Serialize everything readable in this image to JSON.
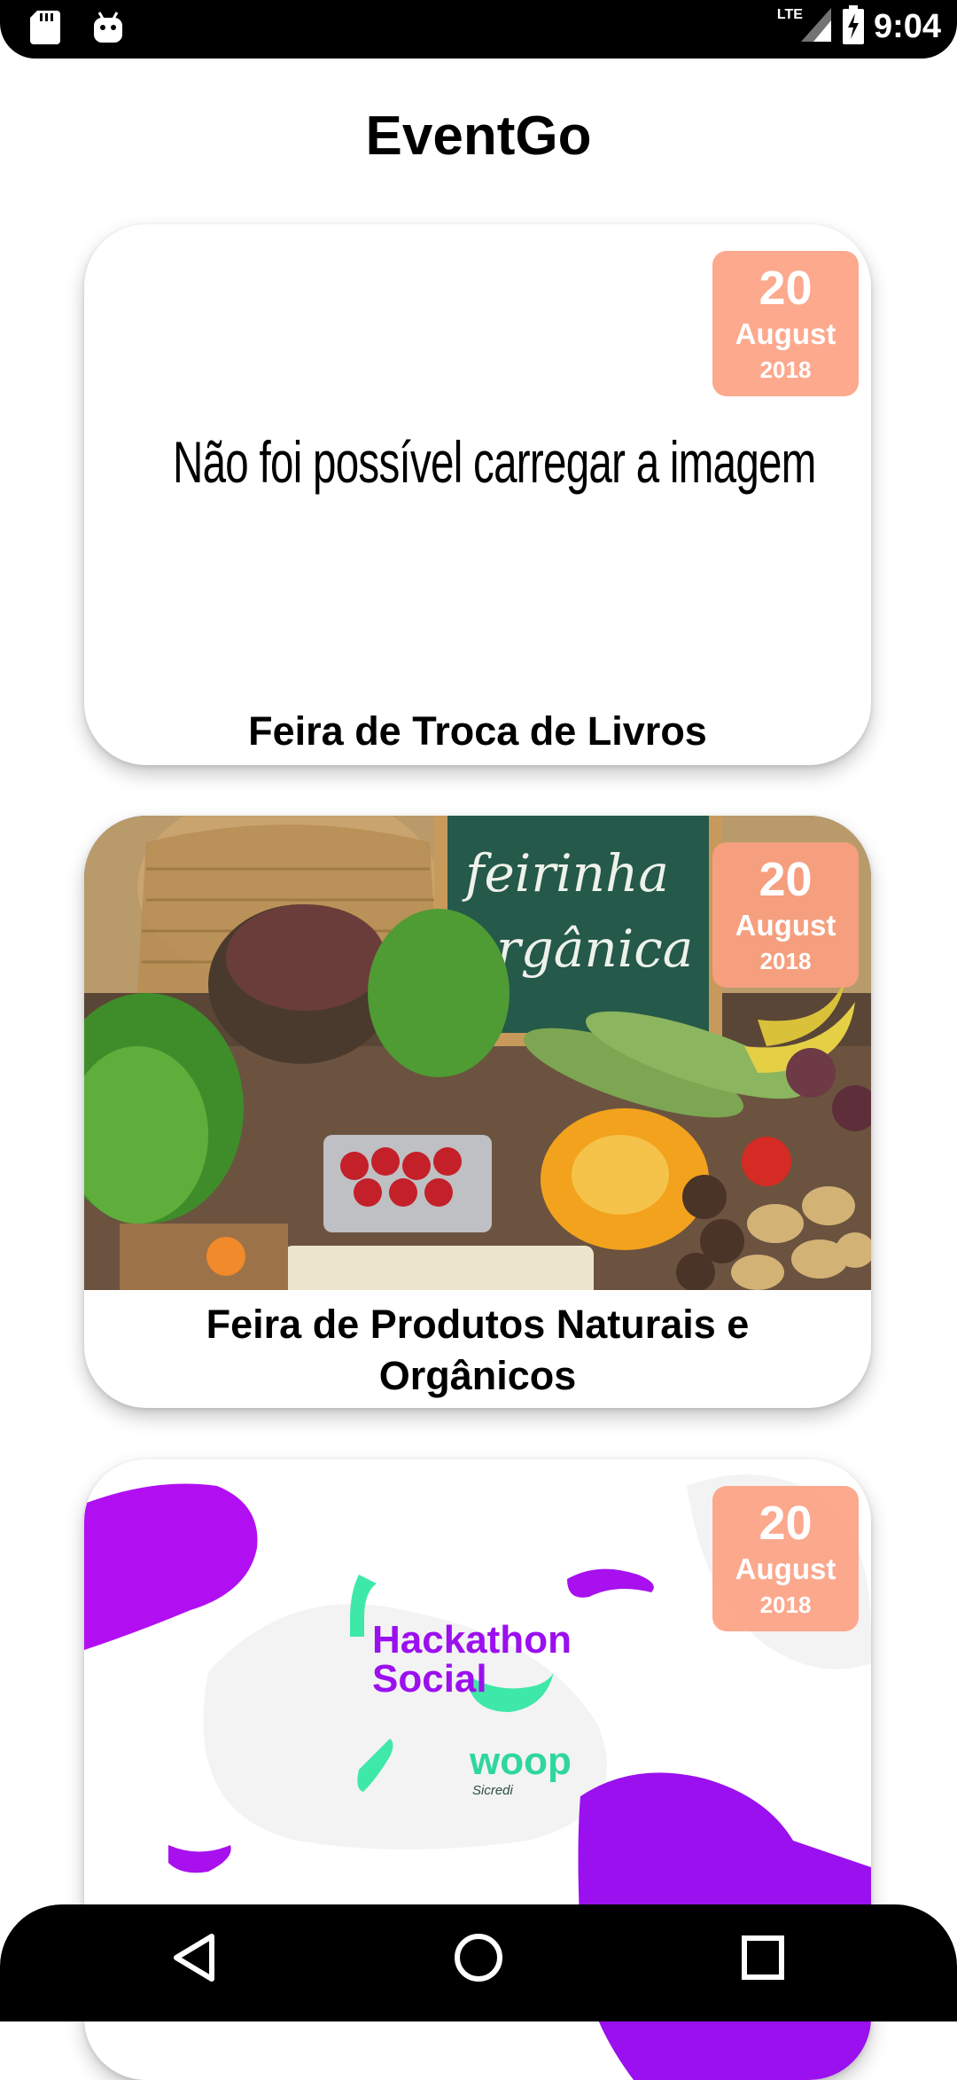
{
  "status_bar": {
    "time": "9:04",
    "network": "LTE"
  },
  "app": {
    "title": "EventGo"
  },
  "events": [
    {
      "title": "Feira de Troca de Livros",
      "day": "20",
      "month": "August",
      "year": "2018",
      "image_error_text": "Não foi possível carregar a imagem"
    },
    {
      "title_line1": "Feira de Produtos Naturais e",
      "title_line2": "Orgânicos",
      "day": "20",
      "month": "August",
      "year": "2018",
      "image_sign_line1": "feirinha",
      "image_sign_line2": "orgânica"
    },
    {
      "day": "20",
      "month": "August",
      "year": "2018",
      "image_text_line1": "Hackathon",
      "image_text_line2": "Social",
      "image_brand": "woop",
      "image_brand_sub": "Sicredi"
    }
  ],
  "colors": {
    "badge": "#FCA082",
    "purple": "#9B10EE",
    "mint": "#3EE8A8"
  }
}
